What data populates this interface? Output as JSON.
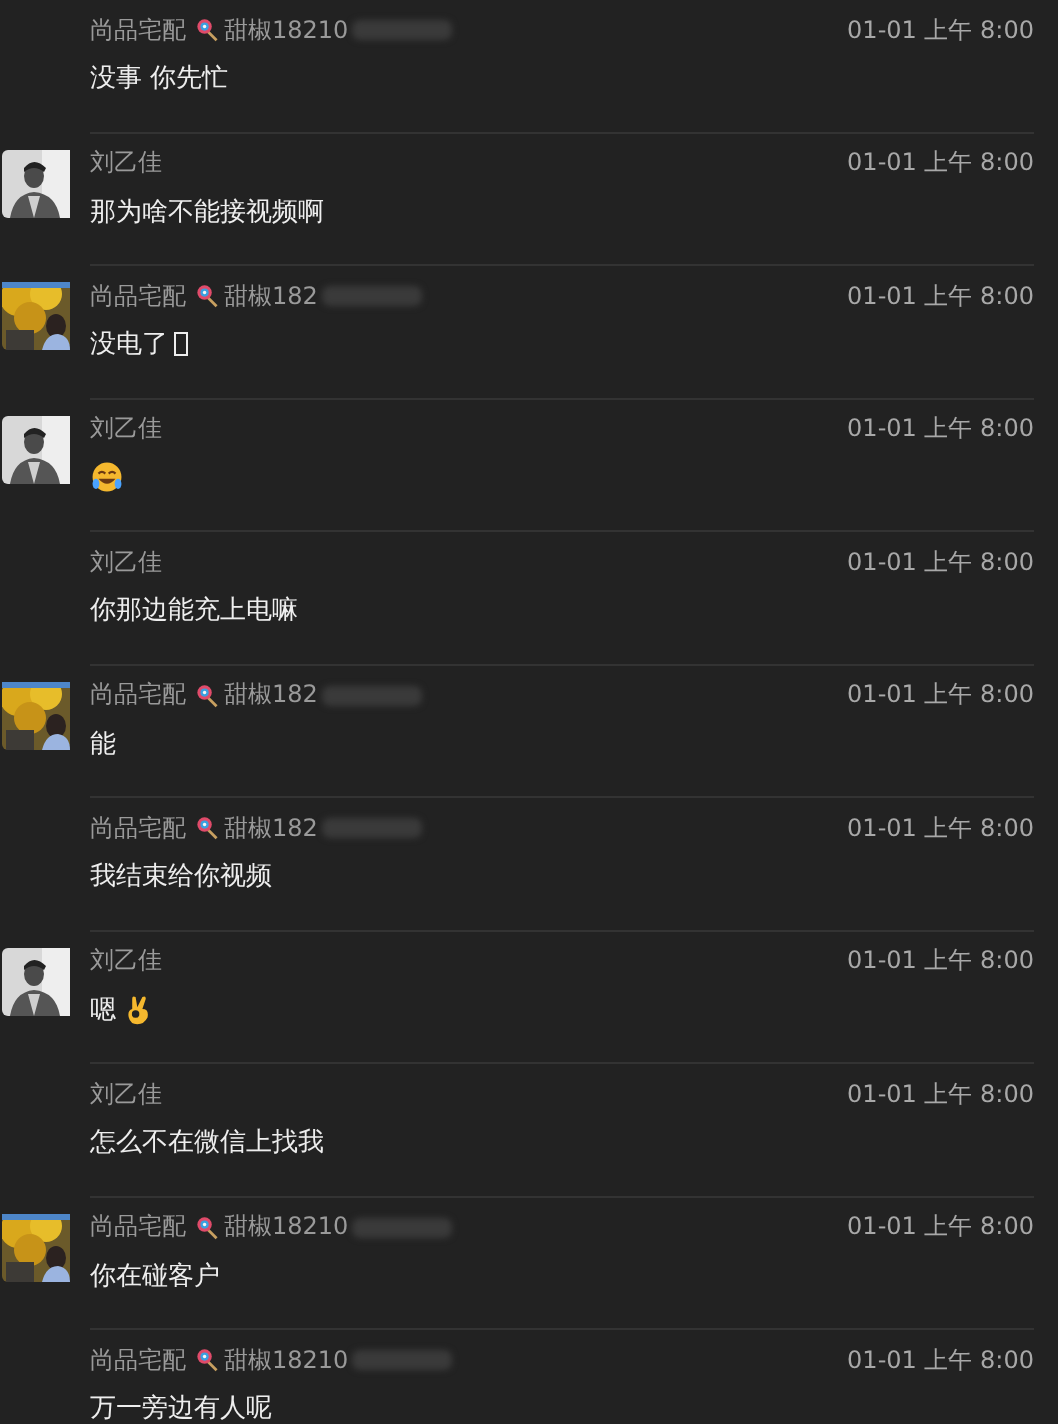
{
  "messages": [
    {
      "sender": "尚品宅配",
      "tag": "甜椒18210",
      "time": "01-01 上午 8:00",
      "parts": [
        {
          "kind": "text",
          "text": "没事 你先忙"
        }
      ]
    },
    {
      "sender": "刘乙佳",
      "avatar": {
        "kind": "picture"
      },
      "time": "01-01 上午 8:00",
      "parts": [
        {
          "kind": "text",
          "text": "那为啥不能接视频啊"
        }
      ]
    },
    {
      "sender": "尚品宅配",
      "tag": "甜椒182",
      "avatar": {
        "kind": "picture"
      },
      "time": "01-01 上午 8:00",
      "parts": [
        {
          "kind": "text",
          "text": "没电了"
        },
        {
          "kind": "missing-glyph"
        }
      ]
    },
    {
      "sender": "刘乙佳",
      "avatar": {
        "kind": "picture"
      },
      "time": "01-01 上午 8:00",
      "parts": [
        {
          "kind": "laugh-emoji"
        }
      ]
    },
    {
      "sender": "刘乙佳",
      "time": "01-01 上午 8:00",
      "parts": [
        {
          "kind": "text",
          "text": "你那边能充上电嘛"
        }
      ]
    },
    {
      "sender": "尚品宅配",
      "tag": "甜椒182",
      "avatar": {
        "kind": "picture"
      },
      "time": "01-01 上午 8:00",
      "parts": [
        {
          "kind": "text",
          "text": "能"
        }
      ]
    },
    {
      "sender": "尚品宅配",
      "tag": "甜椒182",
      "time": "01-01 上午 8:00",
      "parts": [
        {
          "kind": "text",
          "text": "我结束给你视频"
        }
      ]
    },
    {
      "sender": "刘乙佳",
      "avatar": {
        "kind": "picture"
      },
      "time": "01-01 上午 8:00",
      "parts": [
        {
          "kind": "text",
          "text": "嗯"
        },
        {
          "kind": "ok-emoji"
        }
      ]
    },
    {
      "sender": "刘乙佳",
      "time": "01-01 上午 8:00",
      "parts": [
        {
          "kind": "text",
          "text": "怎么不在微信上找我"
        }
      ]
    },
    {
      "sender": "尚品宅配",
      "tag": "甜椒18210",
      "avatar": {
        "kind": "picture"
      },
      "time": "01-01 上午 8:00",
      "parts": [
        {
          "kind": "text",
          "text": "你在碰客户"
        }
      ]
    },
    {
      "sender": "尚品宅配",
      "tag": "甜椒18210",
      "time": "01-01 上午 8:00",
      "parts": [
        {
          "kind": "text",
          "text": "万一旁边有人呢"
        }
      ]
    }
  ]
}
